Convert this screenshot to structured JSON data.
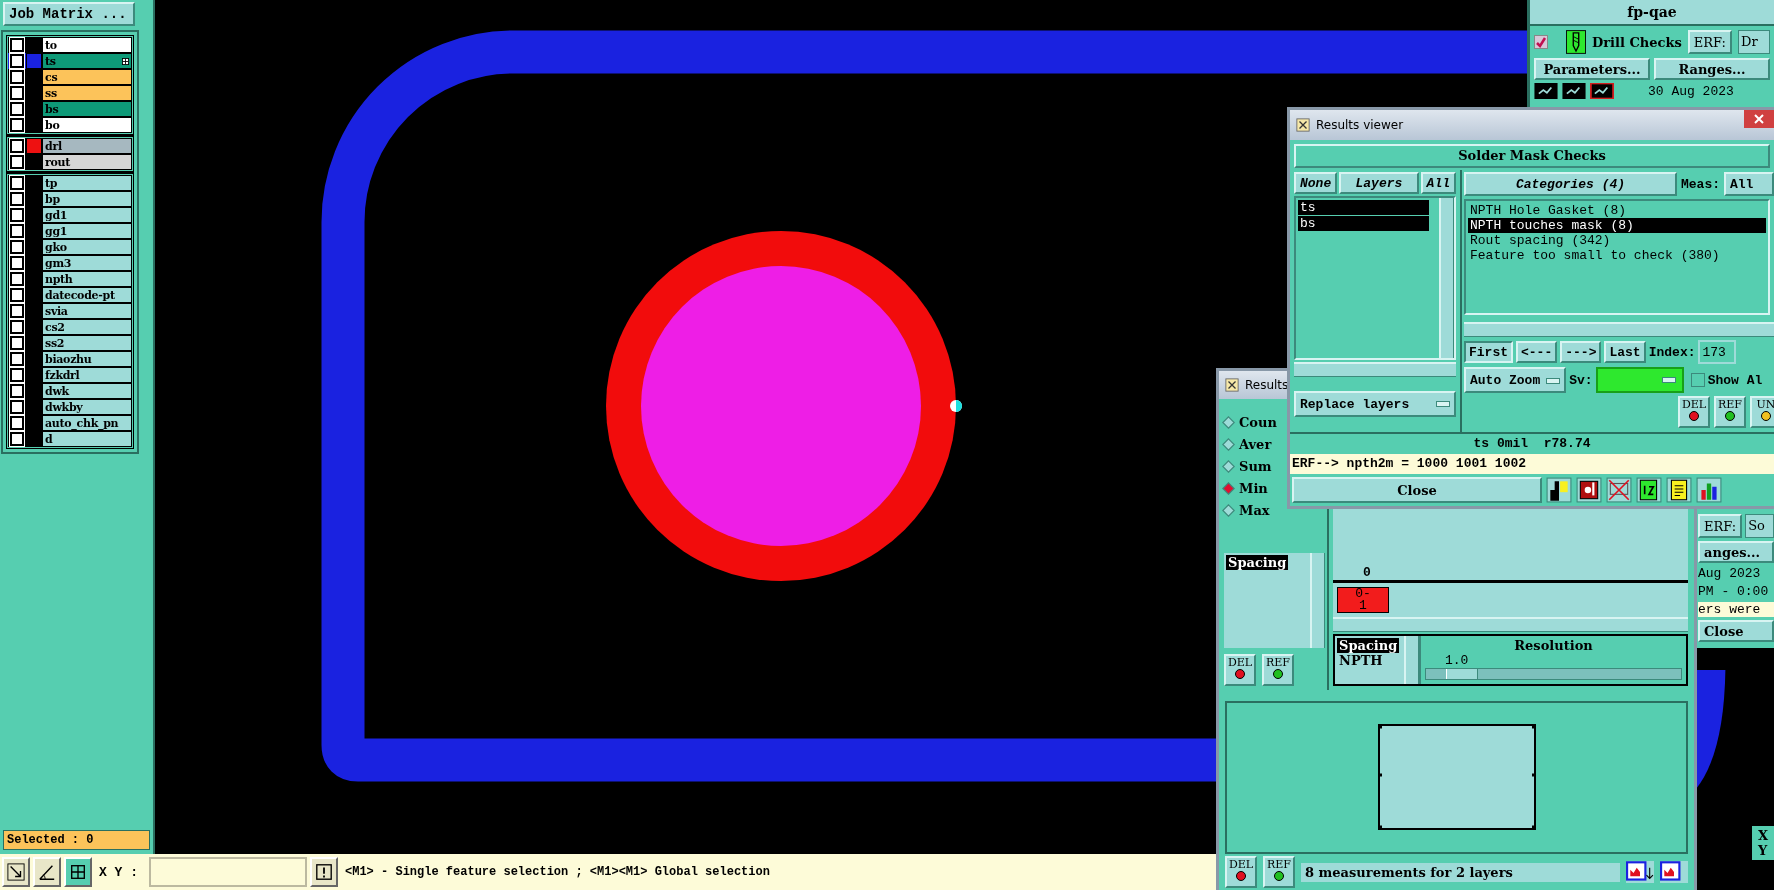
{
  "job_matrix": {
    "button": "Job Matrix ...",
    "groups": [
      {
        "layers": [
          {
            "name": "to",
            "color": "#ffffff",
            "checked": false,
            "selected": false
          },
          {
            "name": "ts",
            "color": "#0e9a78",
            "checked": false,
            "selected": true,
            "swatch": {
              "color": "#1a22e0"
            }
          },
          {
            "name": "cs",
            "color": "#fcc35a",
            "checked": false,
            "selected": false
          },
          {
            "name": "ss",
            "color": "#fcc35a",
            "checked": false,
            "selected": false
          },
          {
            "name": "bs",
            "color": "#0e9a78",
            "checked": false,
            "selected": false
          },
          {
            "name": "bo",
            "color": "#ffffff",
            "checked": false,
            "selected": false
          }
        ]
      },
      {
        "layers": [
          {
            "name": "drl",
            "color": "#a6b8c0",
            "checked": false,
            "selected": false,
            "swatch": {
              "color": "#ee1111"
            }
          },
          {
            "name": "rout",
            "color": "#d6d6d6",
            "checked": false,
            "selected": false
          }
        ]
      },
      {
        "layers": [
          {
            "name": "tp",
            "color": "#9edbd8",
            "checked": false,
            "selected": false
          },
          {
            "name": "bp",
            "color": "#9edbd8",
            "checked": false,
            "selected": false
          },
          {
            "name": "gd1",
            "color": "#9edbd8",
            "checked": false,
            "selected": false
          },
          {
            "name": "gg1",
            "color": "#9edbd8",
            "checked": false,
            "selected": false
          },
          {
            "name": "gko",
            "color": "#9edbd8",
            "checked": false,
            "selected": false
          },
          {
            "name": "gm3",
            "color": "#9edbd8",
            "checked": false,
            "selected": false
          },
          {
            "name": "npth",
            "color": "#9edbd8",
            "checked": false,
            "selected": false
          },
          {
            "name": "datecode-pt",
            "color": "#9edbd8",
            "checked": false,
            "selected": false
          },
          {
            "name": "svia",
            "color": "#9edbd8",
            "checked": false,
            "selected": false
          },
          {
            "name": "cs2",
            "color": "#9edbd8",
            "checked": false,
            "selected": false
          },
          {
            "name": "ss2",
            "color": "#9edbd8",
            "checked": false,
            "selected": false
          },
          {
            "name": "biaozhu",
            "color": "#9edbd8",
            "checked": false,
            "selected": false
          },
          {
            "name": "fzkdrl",
            "color": "#9edbd8",
            "checked": false,
            "selected": false
          },
          {
            "name": "dwk",
            "color": "#9edbd8",
            "checked": false,
            "selected": false
          },
          {
            "name": "dwkby",
            "color": "#9edbd8",
            "checked": false,
            "selected": false
          },
          {
            "name": "auto_chk_pn",
            "color": "#9edbd8",
            "checked": false,
            "selected": false
          },
          {
            "name": "d",
            "color": "#9edbd8",
            "checked": false,
            "selected": false
          }
        ]
      }
    ],
    "status": "Selected : 0"
  },
  "status_bar": {
    "xy_label": "X Y :",
    "hint": "<M1> - Single feature selection ; <M1><M1> Global selection"
  },
  "fp_window": {
    "title": "fp-qae",
    "check": {
      "label": "Drill Checks",
      "checked": true
    },
    "erf_button": "ERF:",
    "erf_value": "Dr",
    "buttons": [
      "Parameters...",
      "Ranges..."
    ],
    "date": "30 Aug 2023",
    "partial": {
      "erf_button": "ERF:",
      "erf_value": "So",
      "ranges_button": "anges...",
      "date": "Aug 2023",
      "time": "PM - 0:00",
      "message": "ers were",
      "close_button": "Close",
      "axis_x": "X",
      "axis_y": "Y"
    }
  },
  "results_viewer": {
    "title": "Results viewer",
    "header": "Solder Mask Checks",
    "layer_buttons": [
      "None",
      "Layers",
      "All"
    ],
    "layers": [
      {
        "name": "ts",
        "selected": true
      },
      {
        "name": "bs",
        "selected": true
      }
    ],
    "categories_button": "Categories (4)",
    "meas_label": "Meas:",
    "meas_value": "All",
    "categories": [
      {
        "label": "NPTH Hole Gasket (8)",
        "selected": false
      },
      {
        "label": "NPTH touches mask (8)",
        "selected": true
      },
      {
        "label": "Rout spacing (342)",
        "selected": false
      },
      {
        "label": "Feature too small to check (380)",
        "selected": false
      }
    ],
    "nav_buttons": [
      "First",
      "<---",
      "--->",
      "Last"
    ],
    "index_label": "Index:",
    "index_value": "173",
    "zoom_button": "Auto Zoom",
    "sv_label": "Sv:",
    "show_all": {
      "label": "Show Al",
      "checked": false
    },
    "replace_button": "Replace layers",
    "action_buttons": [
      "DEL",
      "REF",
      "UN"
    ],
    "status": "ts 0mil  r78.74",
    "erf_line": "ERF--> npth2m = 1000 1001 1002",
    "close_button": "Close"
  },
  "results_window": {
    "title": "Results",
    "options": [
      {
        "label": "Coun",
        "selected": false
      },
      {
        "label": "Aver",
        "selected": false
      },
      {
        "label": "Sum",
        "selected": false
      },
      {
        "label": "Min",
        "selected": true
      },
      {
        "label": "Max",
        "selected": false
      }
    ],
    "measures": [
      {
        "label": "Spacing",
        "selected": true
      }
    ],
    "list_buttons": [
      "DEL",
      "REF"
    ],
    "footer_buttons": [
      "DEL",
      "REF"
    ],
    "histogram": {
      "axis_label": "0",
      "bin_label": "0-1"
    },
    "types": [
      {
        "label": "Spacing",
        "selected": true
      },
      {
        "label": "NPTH",
        "selected": false
      }
    ],
    "resolution": {
      "label": "Resolution",
      "value": "1.0",
      "level": 0.08
    },
    "footer": "8 measurements for 2 layers"
  }
}
